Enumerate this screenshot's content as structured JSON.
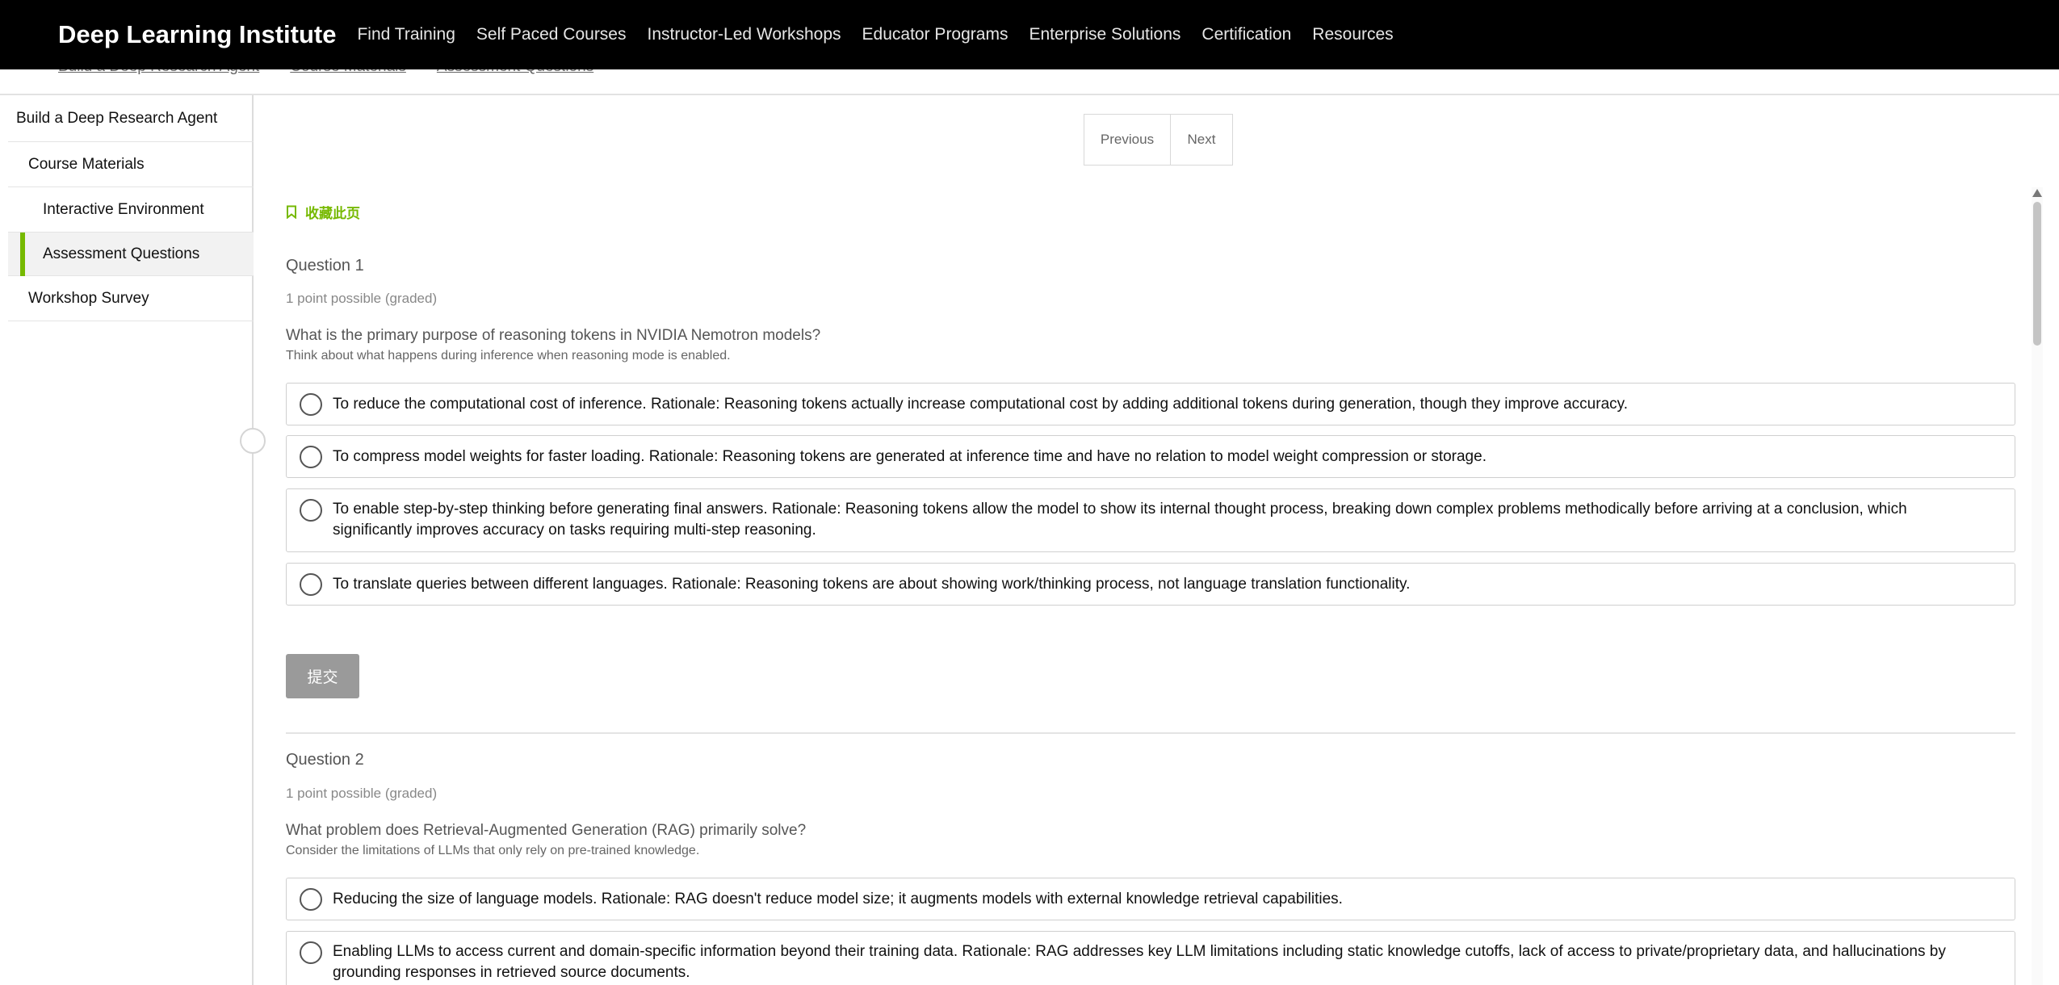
{
  "nav": {
    "brand": "Deep Learning Institute",
    "links": [
      "Find Training",
      "Self Paced Courses",
      "Instructor-Led Workshops",
      "Educator Programs",
      "Enterprise Solutions",
      "Certification",
      "Resources"
    ]
  },
  "breadcrumb": [
    "Build a Deep Research Agent",
    "Course Materials",
    "Assessment Questions"
  ],
  "sidebar": {
    "items": [
      {
        "label": "Build a Deep Research Agent"
      },
      {
        "label": "Course Materials"
      },
      {
        "label": "Interactive Environment"
      },
      {
        "label": "Assessment Questions",
        "active": true
      },
      {
        "label": "Workshop Survey"
      }
    ]
  },
  "pager": {
    "previous": "Previous",
    "next": "Next"
  },
  "bookmark": {
    "label": "收藏此页",
    "icon": "bookmark-icon"
  },
  "questions": [
    {
      "title": "Question 1",
      "points": "1 point possible (graded)",
      "prompt": "What is the primary purpose of reasoning tokens in NVIDIA Nemotron models?",
      "hint": "Think about what happens during inference when reasoning mode is enabled.",
      "options": [
        "To reduce the computational cost of inference. Rationale: Reasoning tokens actually increase computational cost by adding additional tokens during generation, though they improve accuracy.",
        "To compress model weights for faster loading. Rationale: Reasoning tokens are generated at inference time and have no relation to model weight compression or storage.",
        "To enable step-by-step thinking before generating final answers. Rationale: Reasoning tokens allow the model to show its internal thought process, breaking down complex problems methodically before arriving at a conclusion, which significantly improves accuracy on tasks requiring multi-step reasoning.",
        "To translate queries between different languages. Rationale: Reasoning tokens are about showing work/thinking process, not language translation functionality."
      ],
      "submit": "提交"
    },
    {
      "title": "Question 2",
      "points": "1 point possible (graded)",
      "prompt": "What problem does Retrieval-Augmented Generation (RAG) primarily solve?",
      "hint": "Consider the limitations of LLMs that only rely on pre-trained knowledge.",
      "options": [
        "Reducing the size of language models. Rationale: RAG doesn't reduce model size; it augments models with external knowledge retrieval capabilities.",
        "Enabling LLMs to access current and domain-specific information beyond their training data. Rationale: RAG addresses key LLM limitations including static knowledge cutoffs, lack of access to private/proprietary data, and hallucinations by grounding responses in retrieved source documents."
      ]
    }
  ],
  "colors": {
    "accent": "#76b900",
    "nav_bg": "#000000",
    "submit_bg": "#9a9a9a"
  }
}
